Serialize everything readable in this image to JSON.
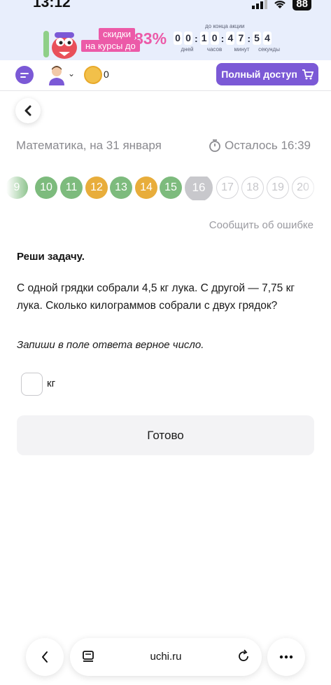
{
  "status_bar": {
    "time": "13:12",
    "battery": "88"
  },
  "promo": {
    "tag_line1": "скидки",
    "tag_line2": "на курсы до",
    "percent": "83%",
    "countdown_title": "до конца акции",
    "digits": [
      "0",
      "0",
      "1",
      "0",
      "4",
      "7",
      "5",
      "4"
    ],
    "labels": [
      "дней",
      "часов",
      "минут",
      "секунды"
    ],
    "accent_color": "#ec5aa8"
  },
  "header": {
    "coins": "0",
    "full_access_label": "Полный доступ",
    "accent_color": "#7b59d6"
  },
  "lesson": {
    "subject": "Математика, на 31 января",
    "timer": "Осталось 16:39",
    "report_link": "Сообщить об ошибке"
  },
  "progress": [
    {
      "label": "9",
      "state": "green"
    },
    {
      "label": "10",
      "state": "green"
    },
    {
      "label": "11",
      "state": "green"
    },
    {
      "label": "12",
      "state": "orange"
    },
    {
      "label": "13",
      "state": "green"
    },
    {
      "label": "14",
      "state": "orange"
    },
    {
      "label": "15",
      "state": "green"
    },
    {
      "label": "16",
      "state": "current"
    },
    {
      "label": "17",
      "state": "empty"
    },
    {
      "label": "18",
      "state": "empty"
    },
    {
      "label": "19",
      "state": "empty"
    },
    {
      "label": "20",
      "state": "empty"
    }
  ],
  "task": {
    "title": "Реши задачу.",
    "text": "С одной грядки собрали 4,5 кг лука. С другой — 7,75 кг лука. Сколько килограммов собрали с двух грядок?",
    "instruction": "Запиши в поле ответа верное число.",
    "answer_value": "",
    "unit": "кг",
    "submit_label": "Готово"
  },
  "browser": {
    "url": "uchi.ru"
  }
}
